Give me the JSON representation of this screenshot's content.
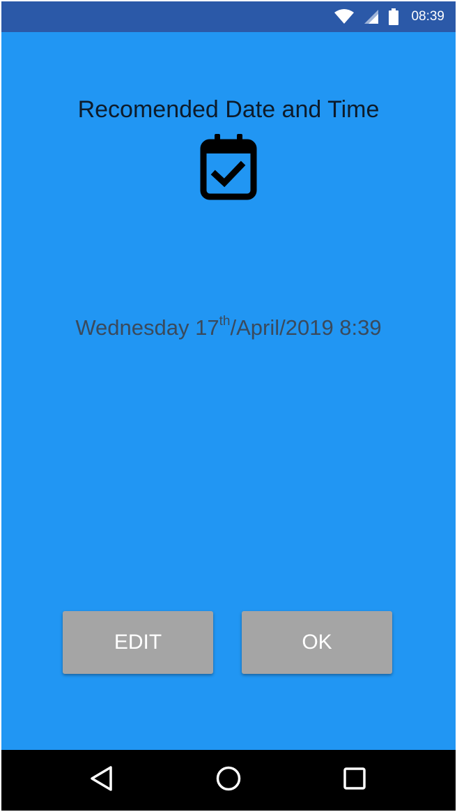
{
  "status_bar": {
    "time": "08:39",
    "icons": [
      "wifi-icon",
      "cell-signal-icon",
      "battery-icon"
    ]
  },
  "screen": {
    "title": "Recomended Date and Time",
    "icon": "calendar-check-icon",
    "date": {
      "day_name": "Wednesday",
      "day_number": "17",
      "ordinal_suffix": "th",
      "rest": "/April/2019 8:39"
    }
  },
  "buttons": {
    "edit_label": "EDIT",
    "ok_label": "OK"
  },
  "navigation": {
    "back": "back-icon",
    "home": "home-icon",
    "recents": "recents-icon"
  },
  "colors": {
    "background": "#2196F3",
    "status_bar": "#2b59a8",
    "button": "#a5a5a5",
    "nav_bar": "#000000"
  }
}
